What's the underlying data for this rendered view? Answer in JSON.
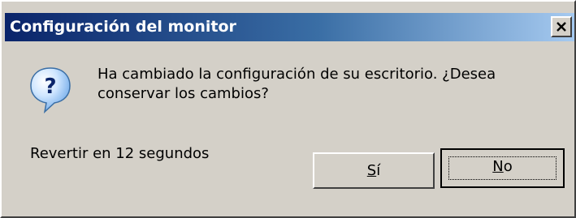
{
  "window": {
    "title": "Configuración del monitor",
    "close_glyph": "✕"
  },
  "icon": {
    "name": "question-icon",
    "glyph": "?"
  },
  "message": {
    "text": "Ha cambiado la configuración de su escritorio. ¿Desea conservar los cambios?"
  },
  "status": {
    "revert_text": "Revertir en 12 segundos"
  },
  "buttons": {
    "yes": {
      "accel": "S",
      "rest": "í"
    },
    "no": {
      "accel": "N",
      "rest": "o"
    }
  },
  "colors": {
    "title_start": "#0a246a",
    "title_end": "#a6caf0",
    "face": "#d4d0c8"
  }
}
